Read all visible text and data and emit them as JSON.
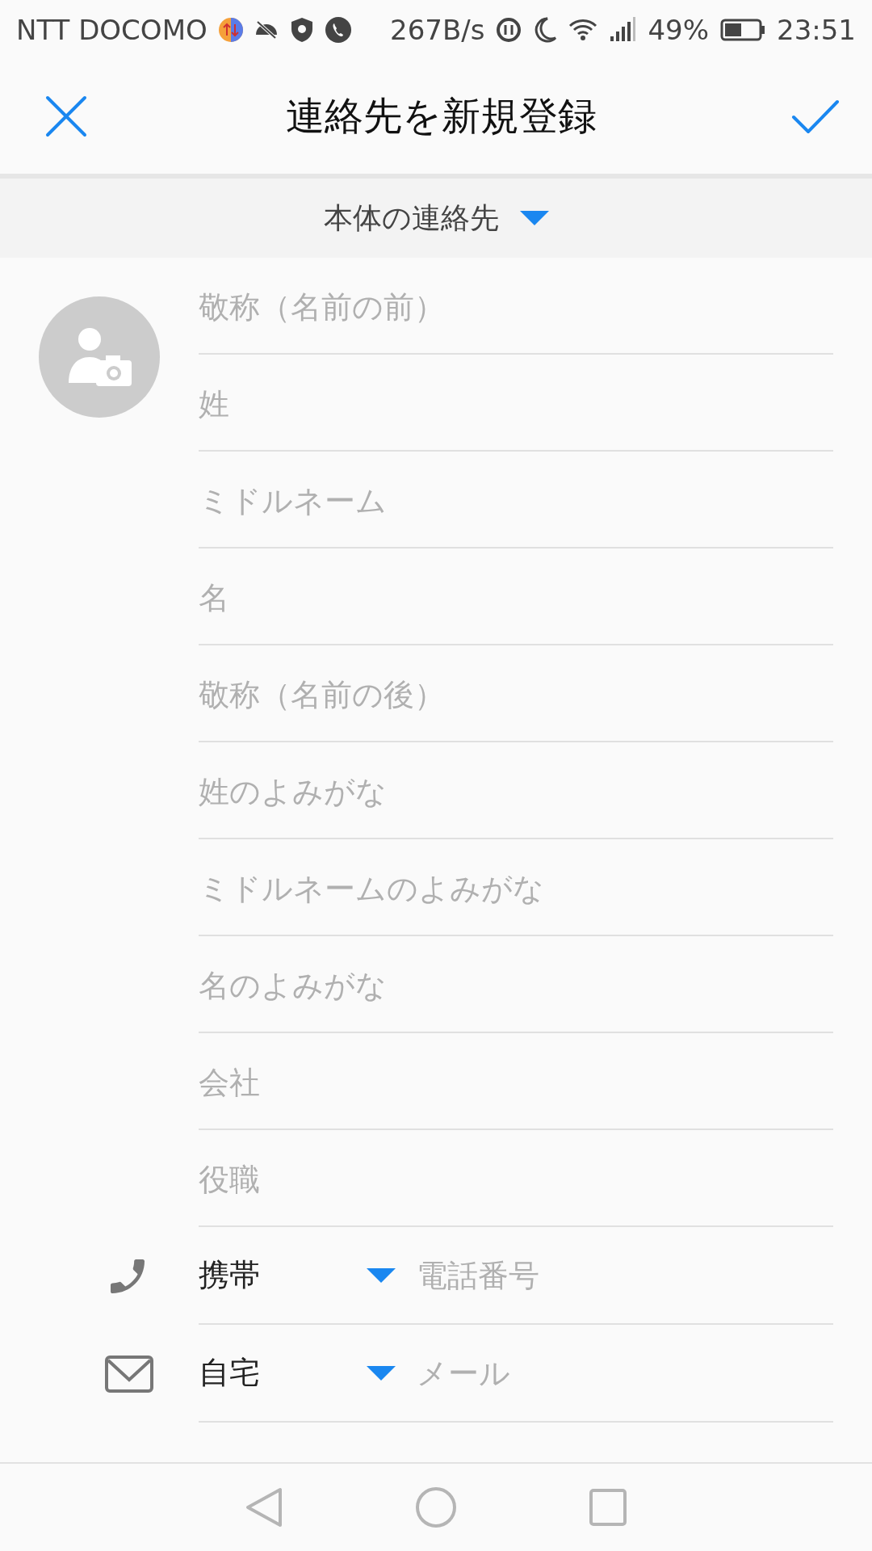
{
  "status_bar": {
    "carrier": "NTT DOCOMO",
    "speed": "267B/s",
    "battery": "49%",
    "time": "23:51"
  },
  "header": {
    "title": "連絡先を新規登録"
  },
  "account": {
    "label": "本体の連絡先"
  },
  "name_fields": [
    {
      "placeholder": "敬称（名前の前）"
    },
    {
      "placeholder": "姓"
    },
    {
      "placeholder": "ミドルネーム"
    },
    {
      "placeholder": "名"
    },
    {
      "placeholder": "敬称（名前の後）"
    },
    {
      "placeholder": "姓のよみがな"
    },
    {
      "placeholder": "ミドルネームのよみがな"
    },
    {
      "placeholder": "名のよみがな"
    },
    {
      "placeholder": "会社"
    },
    {
      "placeholder": "役職"
    }
  ],
  "contact_rows": [
    {
      "kind": "phone",
      "type_label": "携帯",
      "placeholder": "電話番号"
    },
    {
      "kind": "email",
      "type_label": "自宅",
      "placeholder": "メール"
    }
  ]
}
